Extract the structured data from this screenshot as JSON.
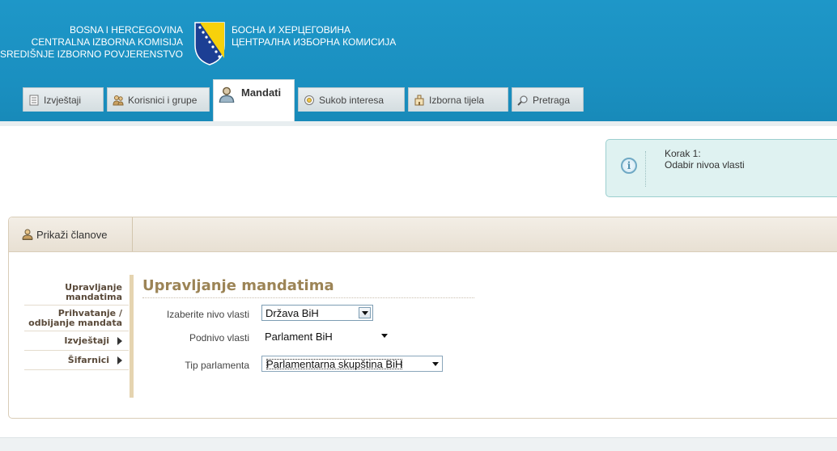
{
  "header": {
    "brand_left": [
      "BOSNA I HERCEGOVINA",
      "CENTRALNA IZBORNA KOMISIJA",
      "SREDIŠNJE IZBORNO POVJERENSTVO"
    ],
    "brand_right": [
      "БОСНА И ХЕРЦЕГОВИНА",
      "ЦЕНТРАЛНА ИЗБОРНА КОМИСИЈА"
    ],
    "coat_icon": "bih-coat-of-arms-icon"
  },
  "tabs": [
    {
      "label": "Izvještaji",
      "icon": "document-icon"
    },
    {
      "label": "Korisnici i grupe",
      "icon": "users-icon"
    },
    {
      "label": "Mandati",
      "icon": "person-icon",
      "active": true
    },
    {
      "label": "Sukob interesa",
      "icon": "circle-icon"
    },
    {
      "label": "Izborna tijela",
      "icon": "building-icon"
    },
    {
      "label": "Pretraga",
      "icon": "magnifier-icon"
    }
  ],
  "info": {
    "step": "Korak 1:",
    "text": "Odabir nivoa vlasti",
    "icon": "info-icon"
  },
  "panel": {
    "show_members": "Prikaži članove"
  },
  "side_menu": {
    "items": [
      {
        "label_1": "Upravljanje",
        "label_2": "mandatima"
      },
      {
        "label_1": "Prihvatanje /",
        "label_2": "odbijanje mandata"
      },
      {
        "label": "Izvještaji",
        "has_arrow": true
      },
      {
        "label": "Šifarnici",
        "has_arrow": true
      }
    ]
  },
  "content": {
    "title": "Upravljanje mandatima",
    "fields": [
      {
        "label": "Izaberite nivo vlasti",
        "value": "Država BiH"
      },
      {
        "label": "Podnivo vlasti",
        "value": "Parlament BiH"
      },
      {
        "label": "Tip parlamenta",
        "value": "Parlamentarna skupština BiH"
      }
    ]
  },
  "colors": {
    "header_blue": "#1a8fc0",
    "title_gold": "#9c8456",
    "info_bg": "#dff2f1"
  }
}
